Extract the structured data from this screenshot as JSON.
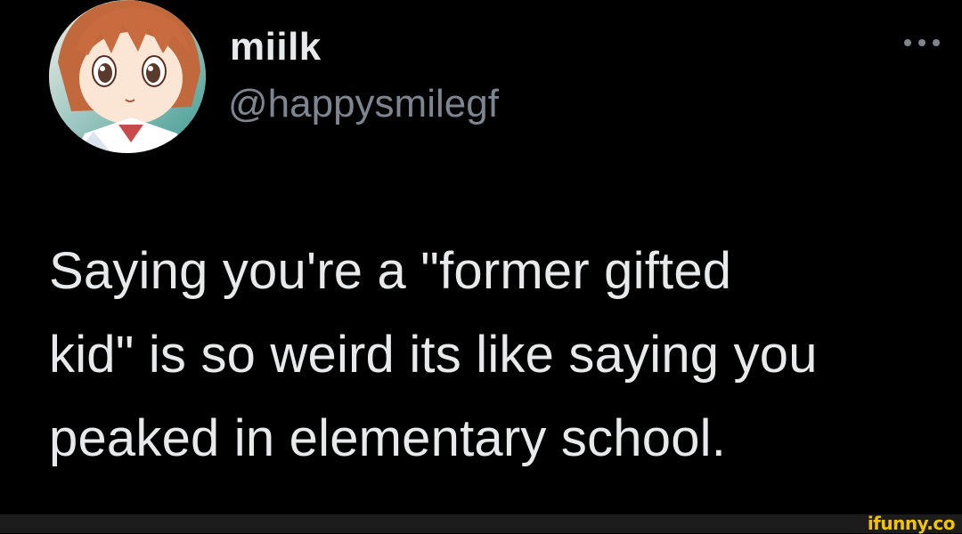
{
  "tweet": {
    "author": {
      "display_name": "miilk",
      "handle": "@happysmilegf",
      "avatar_icon": "anime-girl-avatar"
    },
    "more_icon": "more-options-icon",
    "text": "Saying you're a \"former gifted\nkid\" is so weird its like saying you\npeaked in elementary school."
  },
  "watermark": {
    "text": "ifunny.co",
    "color": "#f2c500"
  },
  "colors": {
    "background": "#000000",
    "text_primary": "#e7e9ea",
    "text_secondary": "#7d8590"
  }
}
